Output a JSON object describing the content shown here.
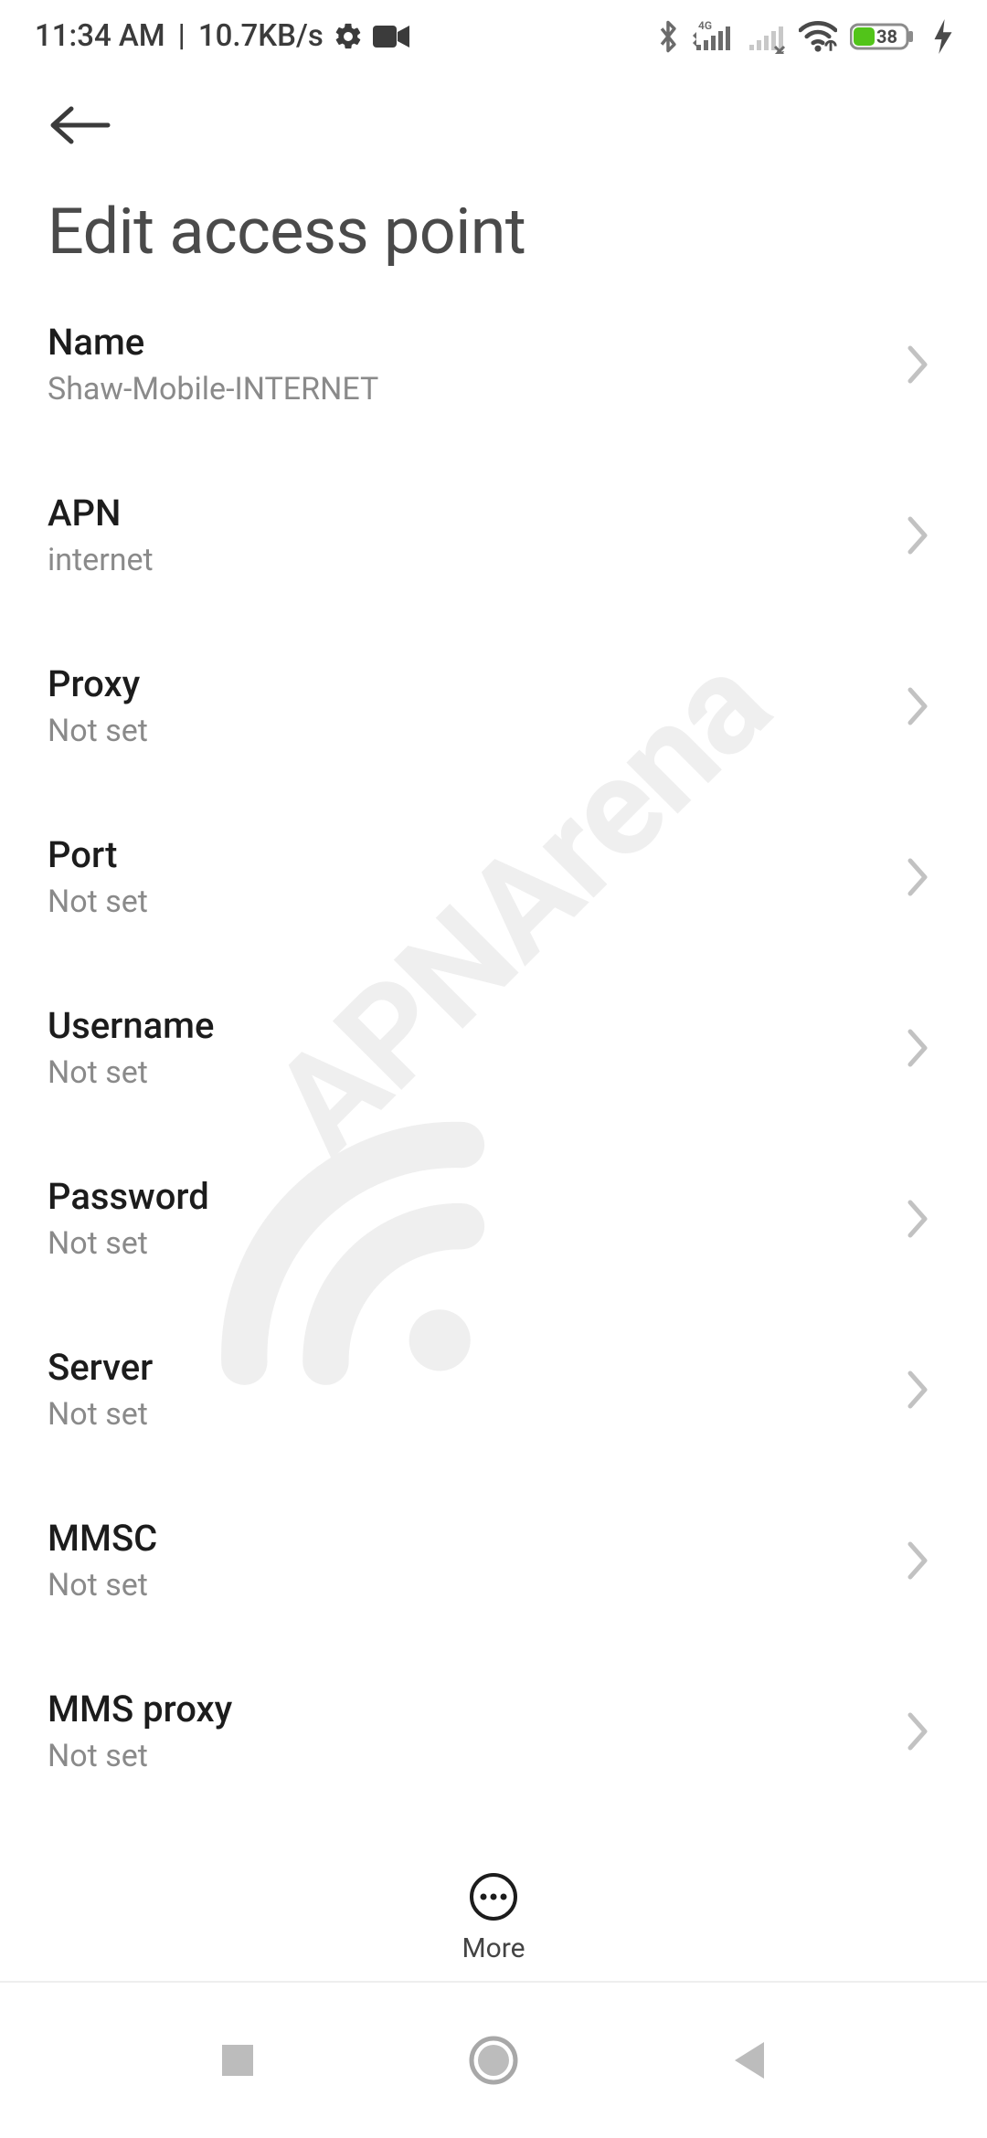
{
  "status": {
    "time": "11:34 AM",
    "net_speed": "10.7KB/s",
    "battery": "38"
  },
  "header": {
    "title": "Edit access point"
  },
  "settings": [
    {
      "title": "Name",
      "value": "Shaw-Mobile-INTERNET"
    },
    {
      "title": "APN",
      "value": "internet"
    },
    {
      "title": "Proxy",
      "value": "Not set"
    },
    {
      "title": "Port",
      "value": "Not set"
    },
    {
      "title": "Username",
      "value": "Not set"
    },
    {
      "title": "Password",
      "value": "Not set"
    },
    {
      "title": "Server",
      "value": "Not set"
    },
    {
      "title": "MMSC",
      "value": "Not set"
    },
    {
      "title": "MMS proxy",
      "value": "Not set"
    }
  ],
  "bottom": {
    "more_label": "More"
  },
  "watermark": "APNArena"
}
